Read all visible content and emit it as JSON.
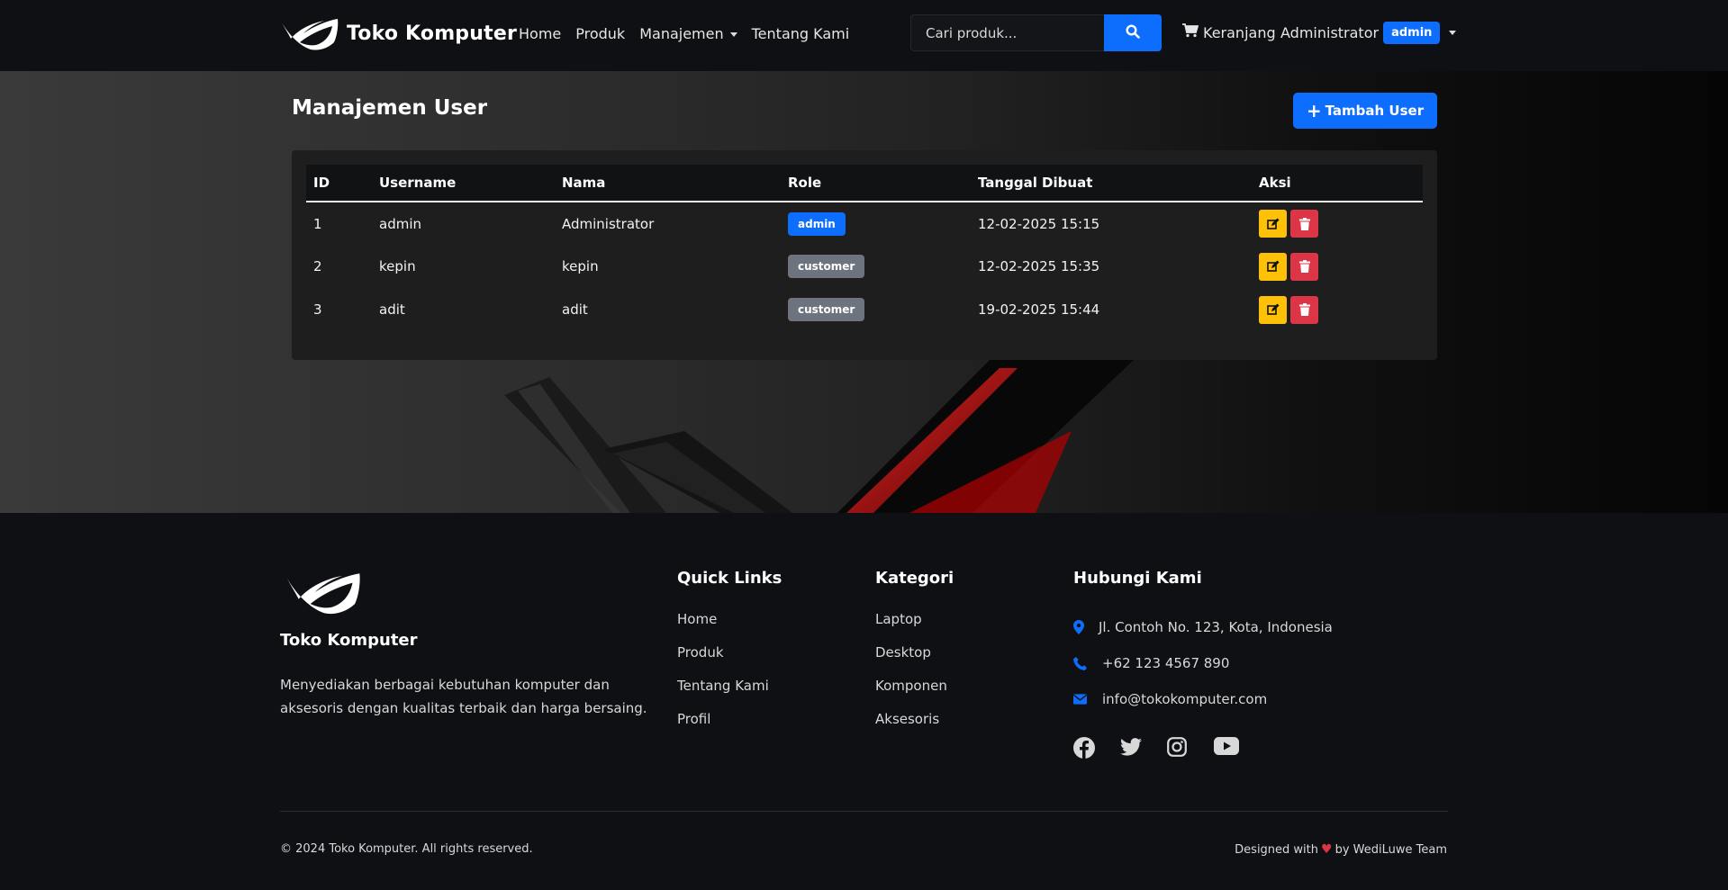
{
  "navbar": {
    "brand": "Toko Komputer",
    "links": [
      "Home",
      "Produk",
      "Manajemen",
      "Tentang Kami"
    ],
    "search_placeholder": "Cari produk...",
    "cart_label": "Keranjang",
    "user_name": "Administrator",
    "user_role_badge": "admin"
  },
  "main": {
    "title": "Manajemen User",
    "add_button": "Tambah User",
    "table": {
      "headers": [
        "ID",
        "Username",
        "Nama",
        "Role",
        "Tanggal Dibuat",
        "Aksi"
      ],
      "rows": [
        {
          "id": "1",
          "username": "admin",
          "nama": "Administrator",
          "role": "admin",
          "created": "12-02-2025 15:15"
        },
        {
          "id": "2",
          "username": "kepin",
          "nama": "kepin",
          "role": "customer",
          "created": "12-02-2025 15:35"
        },
        {
          "id": "3",
          "username": "adit",
          "nama": "adit",
          "role": "customer",
          "created": "19-02-2025 15:44"
        }
      ]
    }
  },
  "footer": {
    "brand": "Toko Komputer",
    "description": "Menyediakan berbagai kebutuhan komputer dan aksesoris dengan kualitas terbaik dan harga bersaing.",
    "quick_links": {
      "title": "Quick Links",
      "items": [
        "Home",
        "Produk",
        "Tentang Kami",
        "Profil"
      ]
    },
    "kategori": {
      "title": "Kategori",
      "items": [
        "Laptop",
        "Desktop",
        "Komponen",
        "Aksesoris"
      ]
    },
    "contact": {
      "title": "Hubungi Kami",
      "address": "Jl. Contoh No. 123, Kota, Indonesia",
      "phone": "+62 123 4567 890",
      "email": "info@tokokomputer.com"
    },
    "socials": [
      "facebook-icon",
      "twitter-icon",
      "instagram-icon",
      "youtube-icon"
    ],
    "copyright": "© 2024 Toko Komputer. All rights reserved.",
    "credit_prefix": "Designed with",
    "credit_suffix": "by WediLuwe Team"
  },
  "colors": {
    "primary": "#0d6efd",
    "warning": "#ffc107",
    "danger": "#dc3545",
    "secondary": "#6c757d",
    "navbar_bg": "#0e1013"
  }
}
